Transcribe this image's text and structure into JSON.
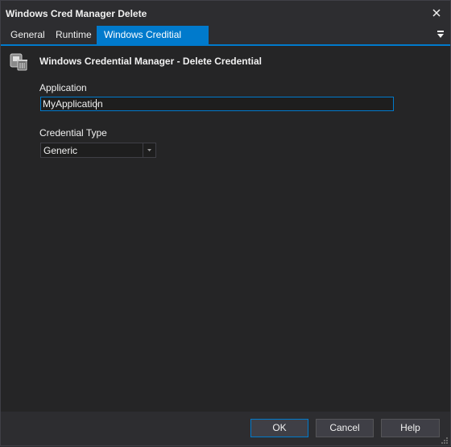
{
  "window": {
    "title": "Windows Cred Manager Delete",
    "close_icon": "close-icon"
  },
  "tabs": [
    {
      "label": "General",
      "active": false
    },
    {
      "label": "Runtime",
      "active": false
    },
    {
      "label": "Windows Creditial Delete",
      "active": true
    }
  ],
  "tab_menu_icon": "dropdown-menu-icon",
  "header": {
    "icon": "credential-delete-icon",
    "title": "Windows Credential Manager - Delete Credential"
  },
  "fields": {
    "application": {
      "label": "Application",
      "value": "MyApplication"
    },
    "credential_type": {
      "label": "Credential Type",
      "selected": "Generic"
    }
  },
  "buttons": {
    "ok": "OK",
    "cancel": "Cancel",
    "help": "Help"
  },
  "colors": {
    "accent": "#007acc",
    "background": "#2d2d30",
    "content": "#252526"
  }
}
